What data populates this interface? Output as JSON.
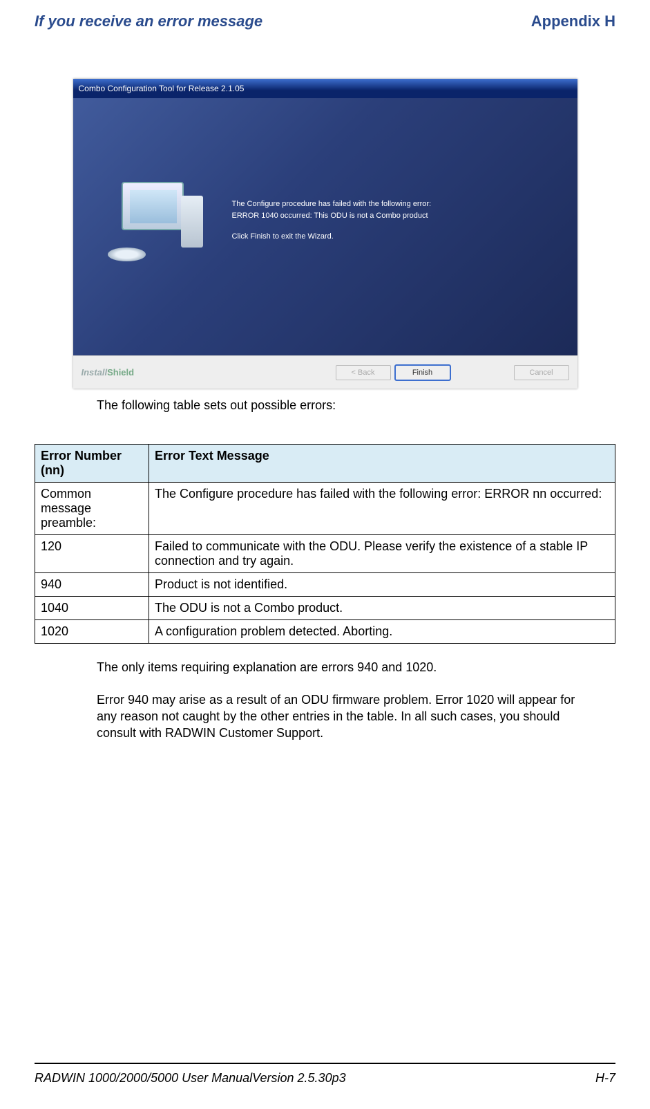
{
  "header": {
    "left": "If you receive an error message",
    "right": "Appendix H"
  },
  "screenshot": {
    "title": "Combo Configuration Tool for Release 2.1.05",
    "line1": "The Configure procedure has failed with the following error:",
    "line2": "ERROR 1040 occurred: This ODU is not a Combo product",
    "line3": "Click Finish to exit the Wizard.",
    "install_shield": "InstallShield",
    "buttons": {
      "back": "< Back",
      "finish": "Finish",
      "cancel": "Cancel"
    }
  },
  "intro_text": "The following table sets out possible errors:",
  "table": {
    "headers": {
      "col1": "Error Number (nn)",
      "col2": "Error Text Message"
    },
    "rows": [
      {
        "c1": "Common message preamble:",
        "c2": "The Configure procedure has failed with the following error: ERROR nn occurred:"
      },
      {
        "c1": "120",
        "c2": "Failed to communicate with the ODU. Please verify the existence of a stable IP connection and try again."
      },
      {
        "c1": "940",
        "c2": "Product is not identified."
      },
      {
        "c1": "1040",
        "c2": "The ODU is not a Combo product."
      },
      {
        "c1": "1020",
        "c2": "A configuration problem detected. Aborting."
      }
    ]
  },
  "explain1": "The only items requiring explanation are errors 940 and 1020.",
  "explain2": "Error 940 may arise as a result of an ODU firmware problem. Error 1020 will appear for any reason not caught by the other entries in the table. In all such cases, you should consult with RADWIN Customer Support.",
  "footer": {
    "left": "RADWIN 1000/2000/5000 User ManualVersion  2.5.30p3",
    "right": "H-7"
  }
}
